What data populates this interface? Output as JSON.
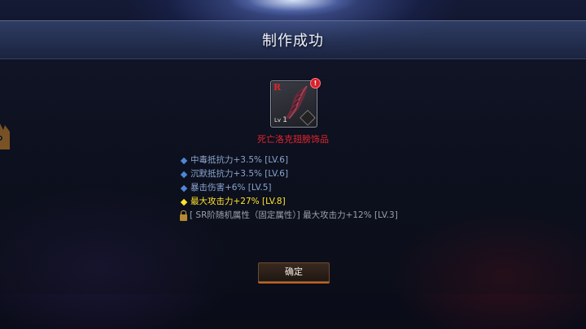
{
  "dialog": {
    "title": "制作成功"
  },
  "item": {
    "rank": "R",
    "level_label": "Lv",
    "level_value": "1",
    "name": "死亡洛克翅膀饰品",
    "name_color": "#e0262e"
  },
  "stats": [
    {
      "text": "中毒抵抗力+3.5% [LV.6]",
      "style": "normal"
    },
    {
      "text": "沉默抵抗力+3.5% [LV.6]",
      "style": "normal"
    },
    {
      "text": "暴击伤害+6% [LV.5]",
      "style": "normal"
    },
    {
      "text": "最大攻击力+27% [LV.8]",
      "style": "highlight"
    },
    {
      "text": "[ SR阶随机属性（固定属性）] 最大攻击力+12% [LV.3]",
      "style": "locked"
    }
  ],
  "confirm_button": {
    "label": "确定"
  },
  "colors": {
    "highlight": "#ffe42a",
    "normal_stat": "#8aa5cf",
    "button_accent": "#c06420"
  }
}
